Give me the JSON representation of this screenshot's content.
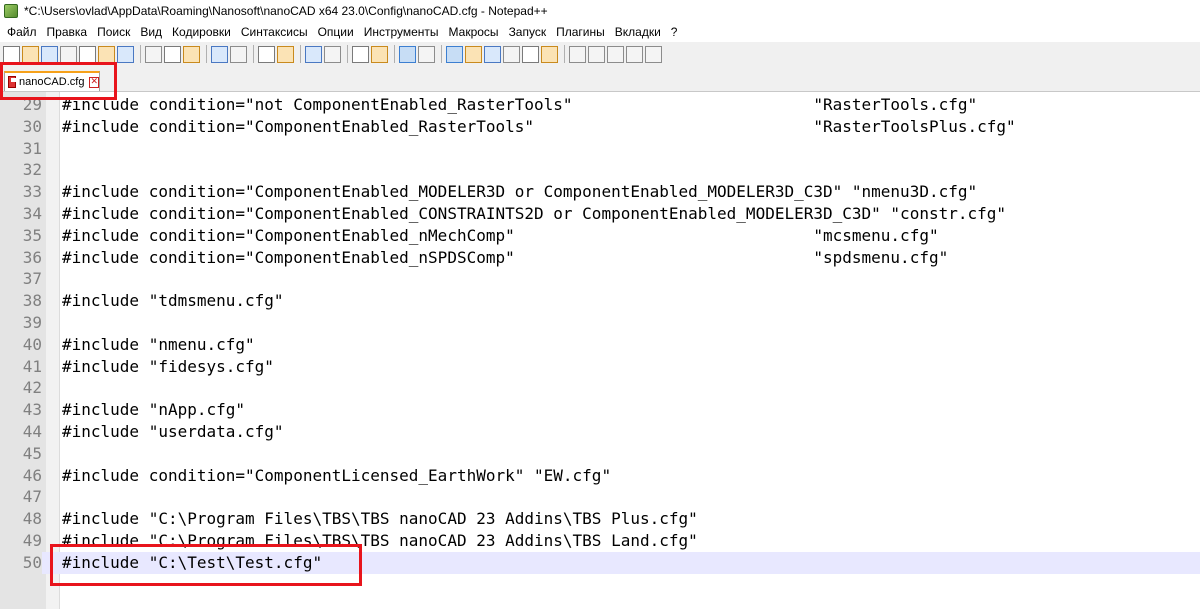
{
  "window": {
    "title": "*C:\\Users\\ovlad\\AppData\\Roaming\\Nanosoft\\nanoCAD x64 23.0\\Config\\nanoCAD.cfg - Notepad++"
  },
  "menu": [
    "Файл",
    "Правка",
    "Поиск",
    "Вид",
    "Кодировки",
    "Синтаксисы",
    "Опции",
    "Инструменты",
    "Макросы",
    "Запуск",
    "Плагины",
    "Вкладки",
    "?"
  ],
  "toolbar": {
    "icons": [
      "new-file-icon",
      "open-file-icon",
      "save-icon",
      "save-all-icon",
      "close-icon",
      "close-all-icon",
      "print-icon",
      "separator",
      "cut-icon",
      "copy-icon",
      "paste-icon",
      "separator",
      "undo-icon",
      "redo-icon",
      "separator",
      "find-icon",
      "replace-icon",
      "separator",
      "zoom-in-icon",
      "zoom-out-icon",
      "separator",
      "sync-vertical-icon",
      "sync-horizontal-icon",
      "separator",
      "word-wrap-icon",
      "show-all-chars-icon",
      "separator",
      "indent-guide-icon",
      "language-icon",
      "document-map-icon",
      "function-list-icon",
      "folder-workspace-icon",
      "monitoring-icon",
      "separator",
      "record-macro-icon",
      "stop-record-icon",
      "play-macro-icon",
      "run-macro-multiple-icon",
      "save-macro-icon"
    ]
  },
  "tab": {
    "label": "nanoCAD.cfg",
    "close_glyph": "✕"
  },
  "editor": {
    "current_line": 50,
    "lines": [
      {
        "n": "29",
        "text": "#include condition=\"not ComponentEnabled_RasterTools\"                         \"RasterTools.cfg\""
      },
      {
        "n": "30",
        "text": "#include condition=\"ComponentEnabled_RasterTools\"                             \"RasterToolsPlus.cfg\""
      },
      {
        "n": "31",
        "text": ""
      },
      {
        "n": "32",
        "text": ""
      },
      {
        "n": "33",
        "text": "#include condition=\"ComponentEnabled_MODELER3D or ComponentEnabled_MODELER3D_C3D\" \"nmenu3D.cfg\""
      },
      {
        "n": "34",
        "text": "#include condition=\"ComponentEnabled_CONSTRAINTS2D or ComponentEnabled_MODELER3D_C3D\" \"constr.cfg\""
      },
      {
        "n": "35",
        "text": "#include condition=\"ComponentEnabled_nMechComp\"                               \"mcsmenu.cfg\""
      },
      {
        "n": "36",
        "text": "#include condition=\"ComponentEnabled_nSPDSComp\"                               \"spdsmenu.cfg\""
      },
      {
        "n": "37",
        "text": ""
      },
      {
        "n": "38",
        "text": "#include \"tdmsmenu.cfg\""
      },
      {
        "n": "39",
        "text": ""
      },
      {
        "n": "40",
        "text": "#include \"nmenu.cfg\""
      },
      {
        "n": "41",
        "text": "#include \"fidesys.cfg\""
      },
      {
        "n": "42",
        "text": ""
      },
      {
        "n": "43",
        "text": "#include \"nApp.cfg\""
      },
      {
        "n": "44",
        "text": "#include \"userdata.cfg\""
      },
      {
        "n": "45",
        "text": ""
      },
      {
        "n": "46",
        "text": "#include condition=\"ComponentLicensed_EarthWork\" \"EW.cfg\""
      },
      {
        "n": "47",
        "text": ""
      },
      {
        "n": "48",
        "text": "#include \"C:\\Program Files\\TBS\\TBS nanoCAD 23 Addins\\TBS Plus.cfg\""
      },
      {
        "n": "49",
        "text": "#include \"C:\\Program Files\\TBS\\TBS nanoCAD 23 Addins\\TBS Land.cfg\""
      },
      {
        "n": "50",
        "text": "#include \"C:\\Test\\Test.cfg\""
      }
    ]
  },
  "annotations": {
    "color": "#e8141c"
  }
}
